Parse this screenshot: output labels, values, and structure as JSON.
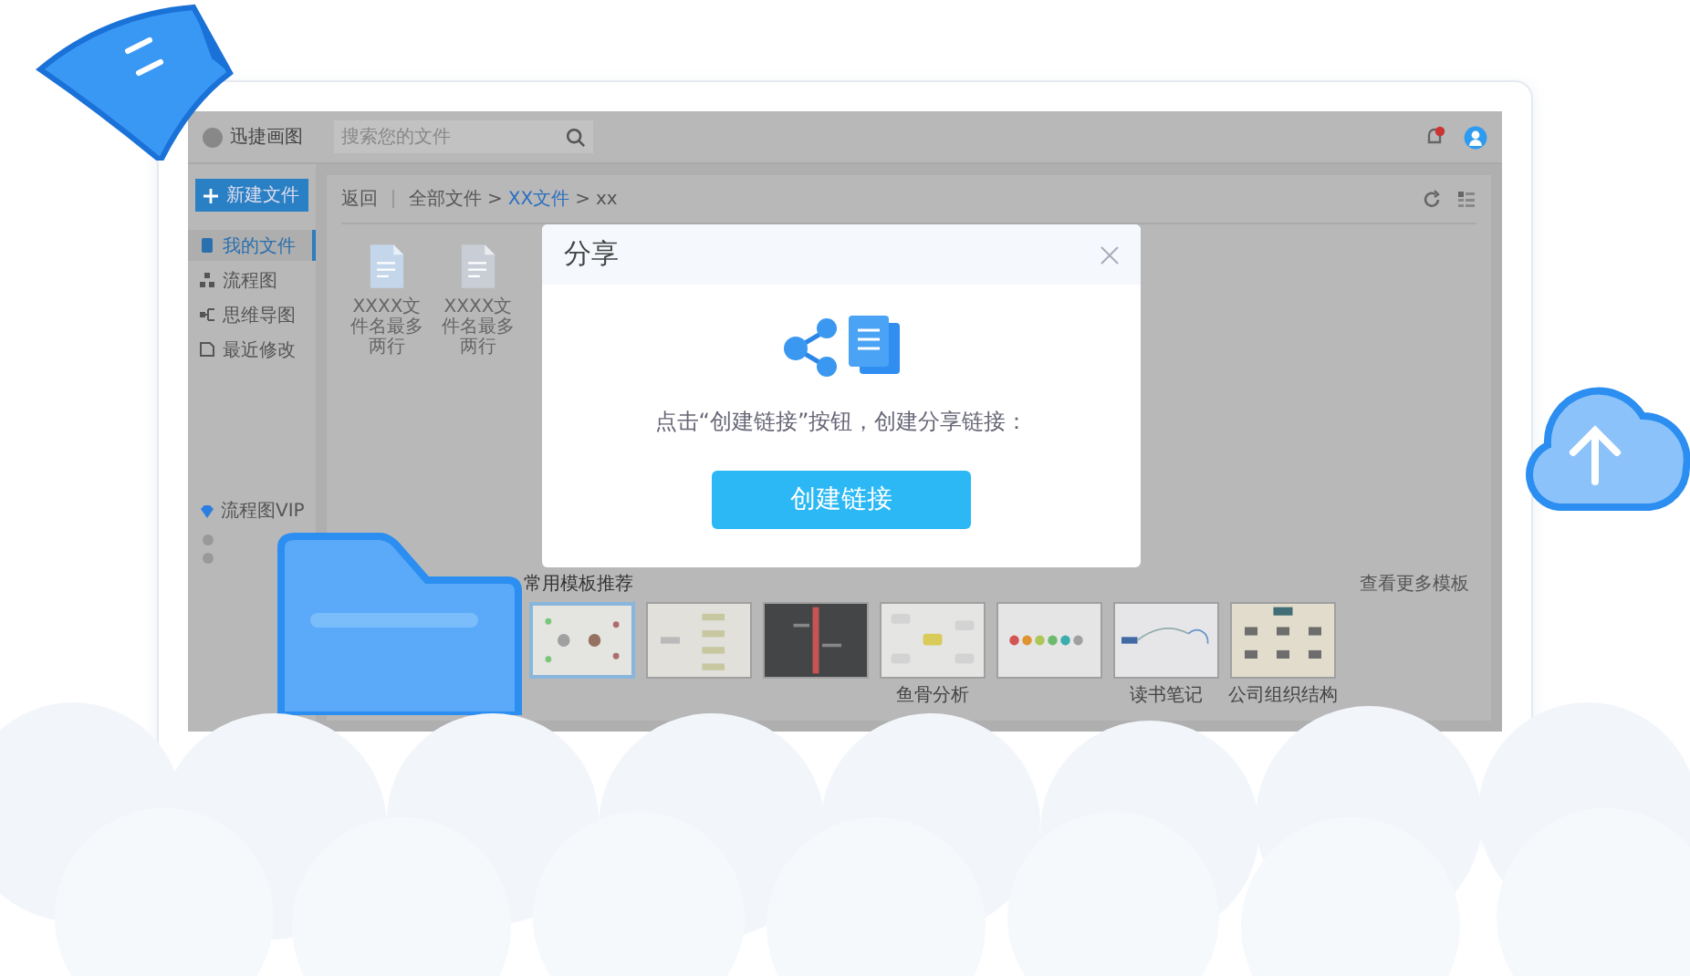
{
  "app": {
    "logo": "迅捷画图",
    "search": {
      "placeholder": "搜索您的文件"
    },
    "notification": {
      "unread": true
    },
    "new_button": "新建文件",
    "nav": [
      {
        "label": "我的文件",
        "kind": "file",
        "selected": true
      },
      {
        "label": "流程图",
        "kind": "flow",
        "selected": false
      },
      {
        "label": "思维导图",
        "kind": "mind",
        "selected": false
      },
      {
        "label": "最近修改",
        "kind": "recent",
        "selected": false
      }
    ],
    "vip": "流程图VIP"
  },
  "toolbar": {
    "back": "返回",
    "separator": ">",
    "breadcrumb": [
      {
        "label": "全部文件",
        "link": false
      },
      {
        "label": "XX文件",
        "link": true
      },
      {
        "label": "xx",
        "link": false
      }
    ]
  },
  "files": [
    {
      "name": "XXXX文件名最多两行",
      "kind": "flow"
    },
    {
      "name": "XXXX文件名最多两行",
      "kind": "mind"
    }
  ],
  "templates": {
    "title": "常用模板推荐",
    "more": "查看更多模板",
    "items": [
      {
        "kind": "relation",
        "selected": true
      },
      {
        "kind": "tree",
        "selected": false
      },
      {
        "kind": "dark",
        "selected": false
      },
      {
        "kind": "fishbone",
        "label": "鱼骨分析",
        "selected": false
      },
      {
        "kind": "timeline",
        "selected": false
      },
      {
        "kind": "notes",
        "label": "读书笔记",
        "selected": false
      },
      {
        "kind": "org",
        "label": "公司组织结构",
        "selected": false
      }
    ]
  },
  "dialog": {
    "title": "分享",
    "message": "点击“创建链接”按钮，创建分享链接：",
    "button": "创建链接"
  }
}
